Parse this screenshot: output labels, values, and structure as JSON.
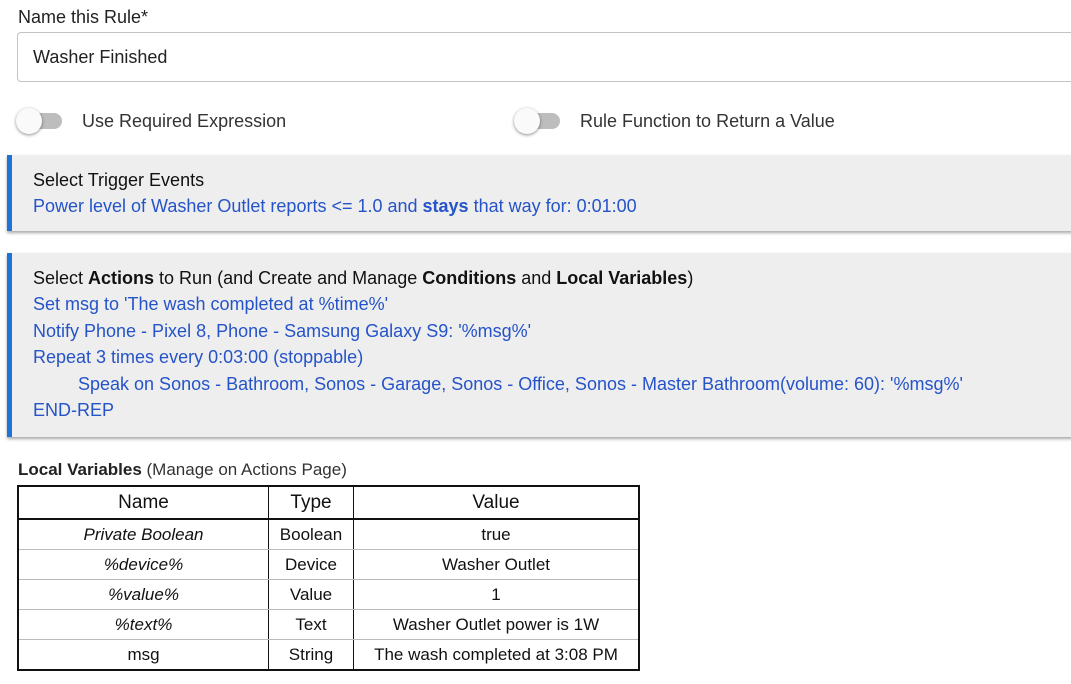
{
  "rule_name": {
    "label": "Name this Rule*",
    "value": "Washer Finished"
  },
  "toggles": [
    {
      "label": "Use Required Expression",
      "on": false
    },
    {
      "label": "Rule Function to Return a Value",
      "on": false
    }
  ],
  "trigger": {
    "title": "Select Trigger Events",
    "line_before": "Power level of Washer Outlet reports <= 1.0 and ",
    "line_bold": "stays",
    "line_after": " that way for: 0:01:00"
  },
  "actions": {
    "title_parts": [
      "Select ",
      "Actions",
      " to Run (and Create and Manage ",
      "Conditions",
      " and ",
      "Local Variables",
      ")"
    ],
    "lines": [
      "Set msg to 'The wash completed at %time%'",
      "Notify Phone - Pixel 8, Phone - Samsung Galaxy S9: '%msg%'",
      "Repeat 3 times every 0:03:00 (stoppable)",
      "Speak on Sonos - Bathroom, Sonos - Garage, Sonos - Office, Sonos - Master Bathroom(volume: 60): '%msg%'",
      "END-REP"
    ]
  },
  "local_variables": {
    "title": "Local Variables",
    "subtitle": " (Manage on Actions Page)",
    "columns": [
      "Name",
      "Type",
      "Value"
    ],
    "rows": [
      {
        "name": "Private Boolean",
        "type": "Boolean",
        "value": "true"
      },
      {
        "name": "%device%",
        "type": "Device",
        "value": "Washer Outlet"
      },
      {
        "name": "%value%",
        "type": "Value",
        "value": "1"
      },
      {
        "name": "%text%",
        "type": "Text",
        "value": "Washer Outlet power is 1W"
      },
      {
        "name": "msg",
        "type": "String",
        "value": "The wash completed at 3:08 PM"
      }
    ]
  },
  "colors": {
    "accent_border": "#1e73d8",
    "link_text": "#2553c8",
    "panel_bg": "#eeeeee"
  }
}
